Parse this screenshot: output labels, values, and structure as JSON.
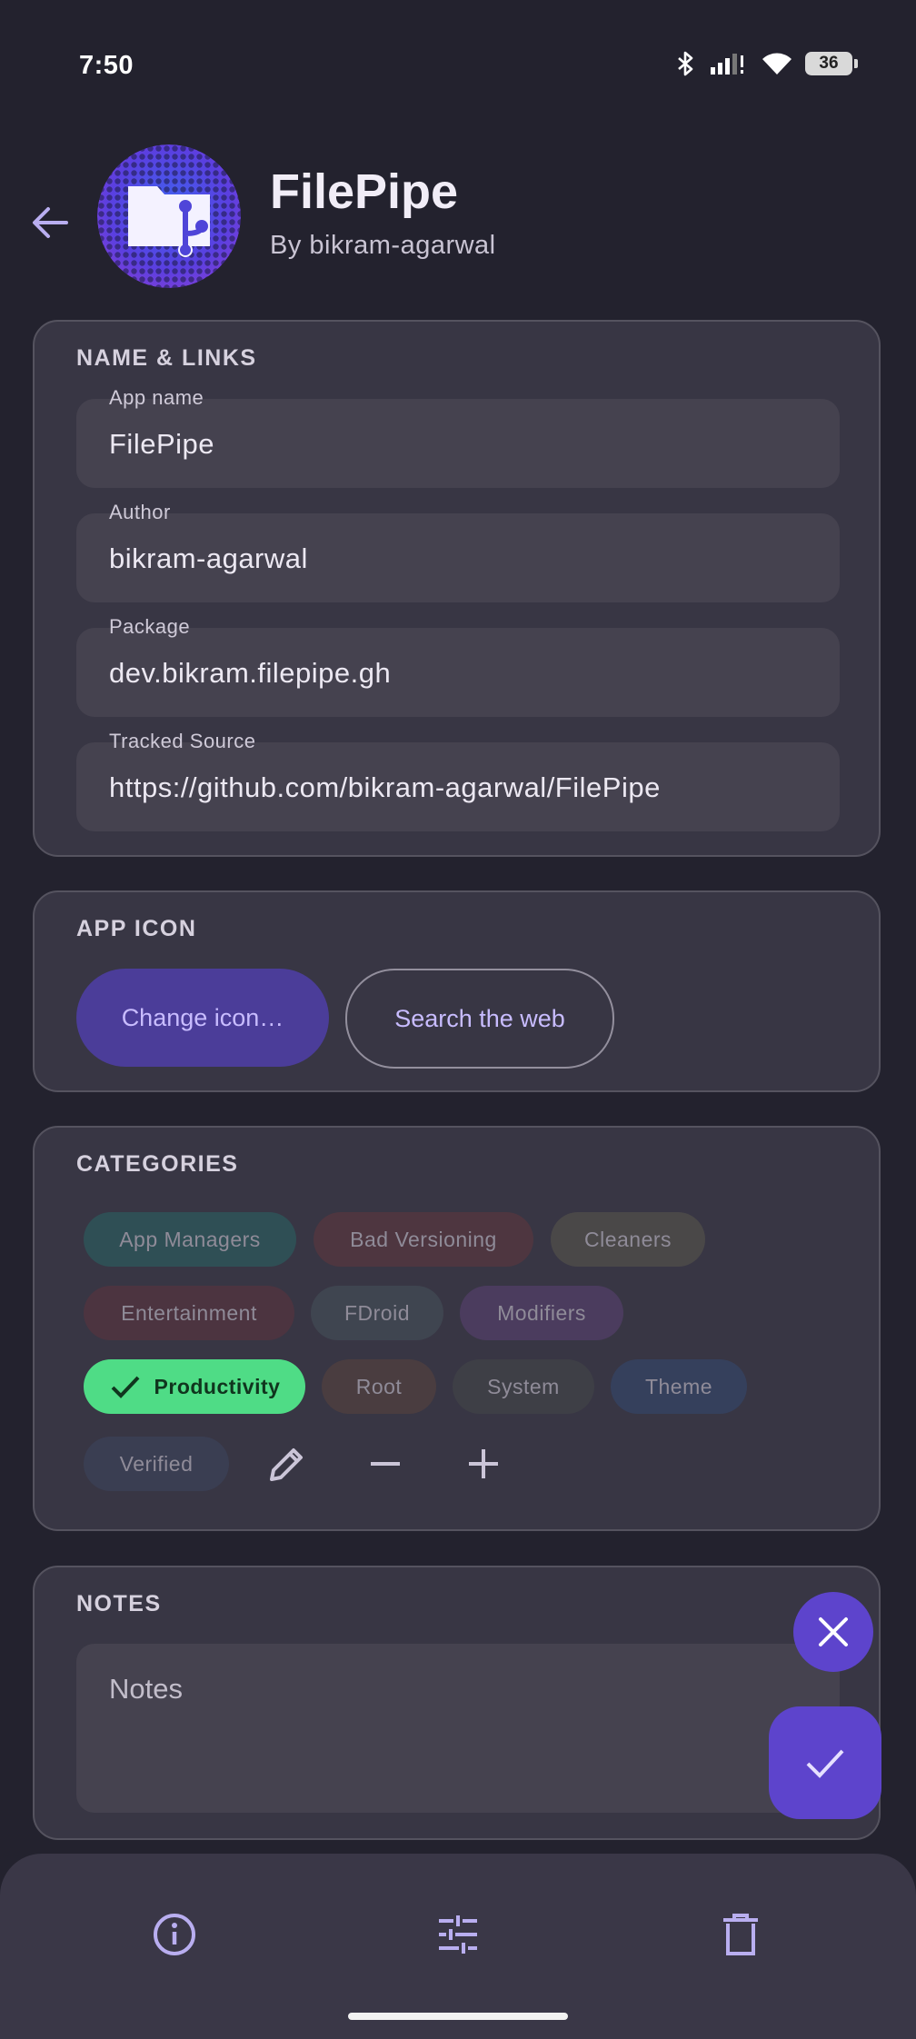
{
  "status_bar": {
    "time": "7:50",
    "battery": "36"
  },
  "header": {
    "title": "FilePipe",
    "author": "By bikram-agarwal",
    "back_icon": "arrow-back-icon",
    "logo_icon": "folder-git-icon"
  },
  "name_links": {
    "title": "NAME & LINKS",
    "fields": [
      {
        "label": "App name",
        "value": "FilePipe"
      },
      {
        "label": "Author",
        "value": "bikram-agarwal"
      },
      {
        "label": "Package",
        "value": "dev.bikram.filepipe.gh"
      },
      {
        "label": "Tracked Source",
        "value": "https://github.com/bikram-agarwal/FilePipe"
      }
    ]
  },
  "app_icon": {
    "title": "APP ICON",
    "change_label": "Change icon…",
    "search_label": "Search the web"
  },
  "categories": {
    "title": "CATEGORIES",
    "chips": [
      {
        "label": "App Managers",
        "color": "#2f4f55",
        "selected": false
      },
      {
        "label": "Bad Versioning",
        "color": "#4e3640",
        "selected": false
      },
      {
        "label": "Cleaners",
        "color": "#4a4848",
        "selected": false
      },
      {
        "label": "Entertainment",
        "color": "#4c3440",
        "selected": false
      },
      {
        "label": "FDroid",
        "color": "#3f4550",
        "selected": false
      },
      {
        "label": "Modifiers",
        "color": "#4b3c5e",
        "selected": false
      },
      {
        "label": "Productivity",
        "color": "#4fdc86",
        "selected": true
      },
      {
        "label": "Root",
        "color": "#4a3d40",
        "selected": false
      },
      {
        "label": "System",
        "color": "#3e3f46",
        "selected": false
      },
      {
        "label": "Theme",
        "color": "#35405c",
        "selected": false
      },
      {
        "label": "Verified",
        "color": "#3a3e52",
        "selected": false
      }
    ],
    "tools": [
      "edit-icon",
      "remove-icon",
      "add-icon"
    ]
  },
  "notes": {
    "title": "NOTES",
    "placeholder": "Notes"
  },
  "fabs": {
    "cancel_icon": "close-icon",
    "save_icon": "check-icon"
  },
  "bottom_nav": [
    "info-icon",
    "tune-icon",
    "delete-icon"
  ],
  "colors": {
    "accent": "#5d44cc",
    "background": "#23222e",
    "card": "#383644",
    "selected_chip": "#4fdc86"
  }
}
